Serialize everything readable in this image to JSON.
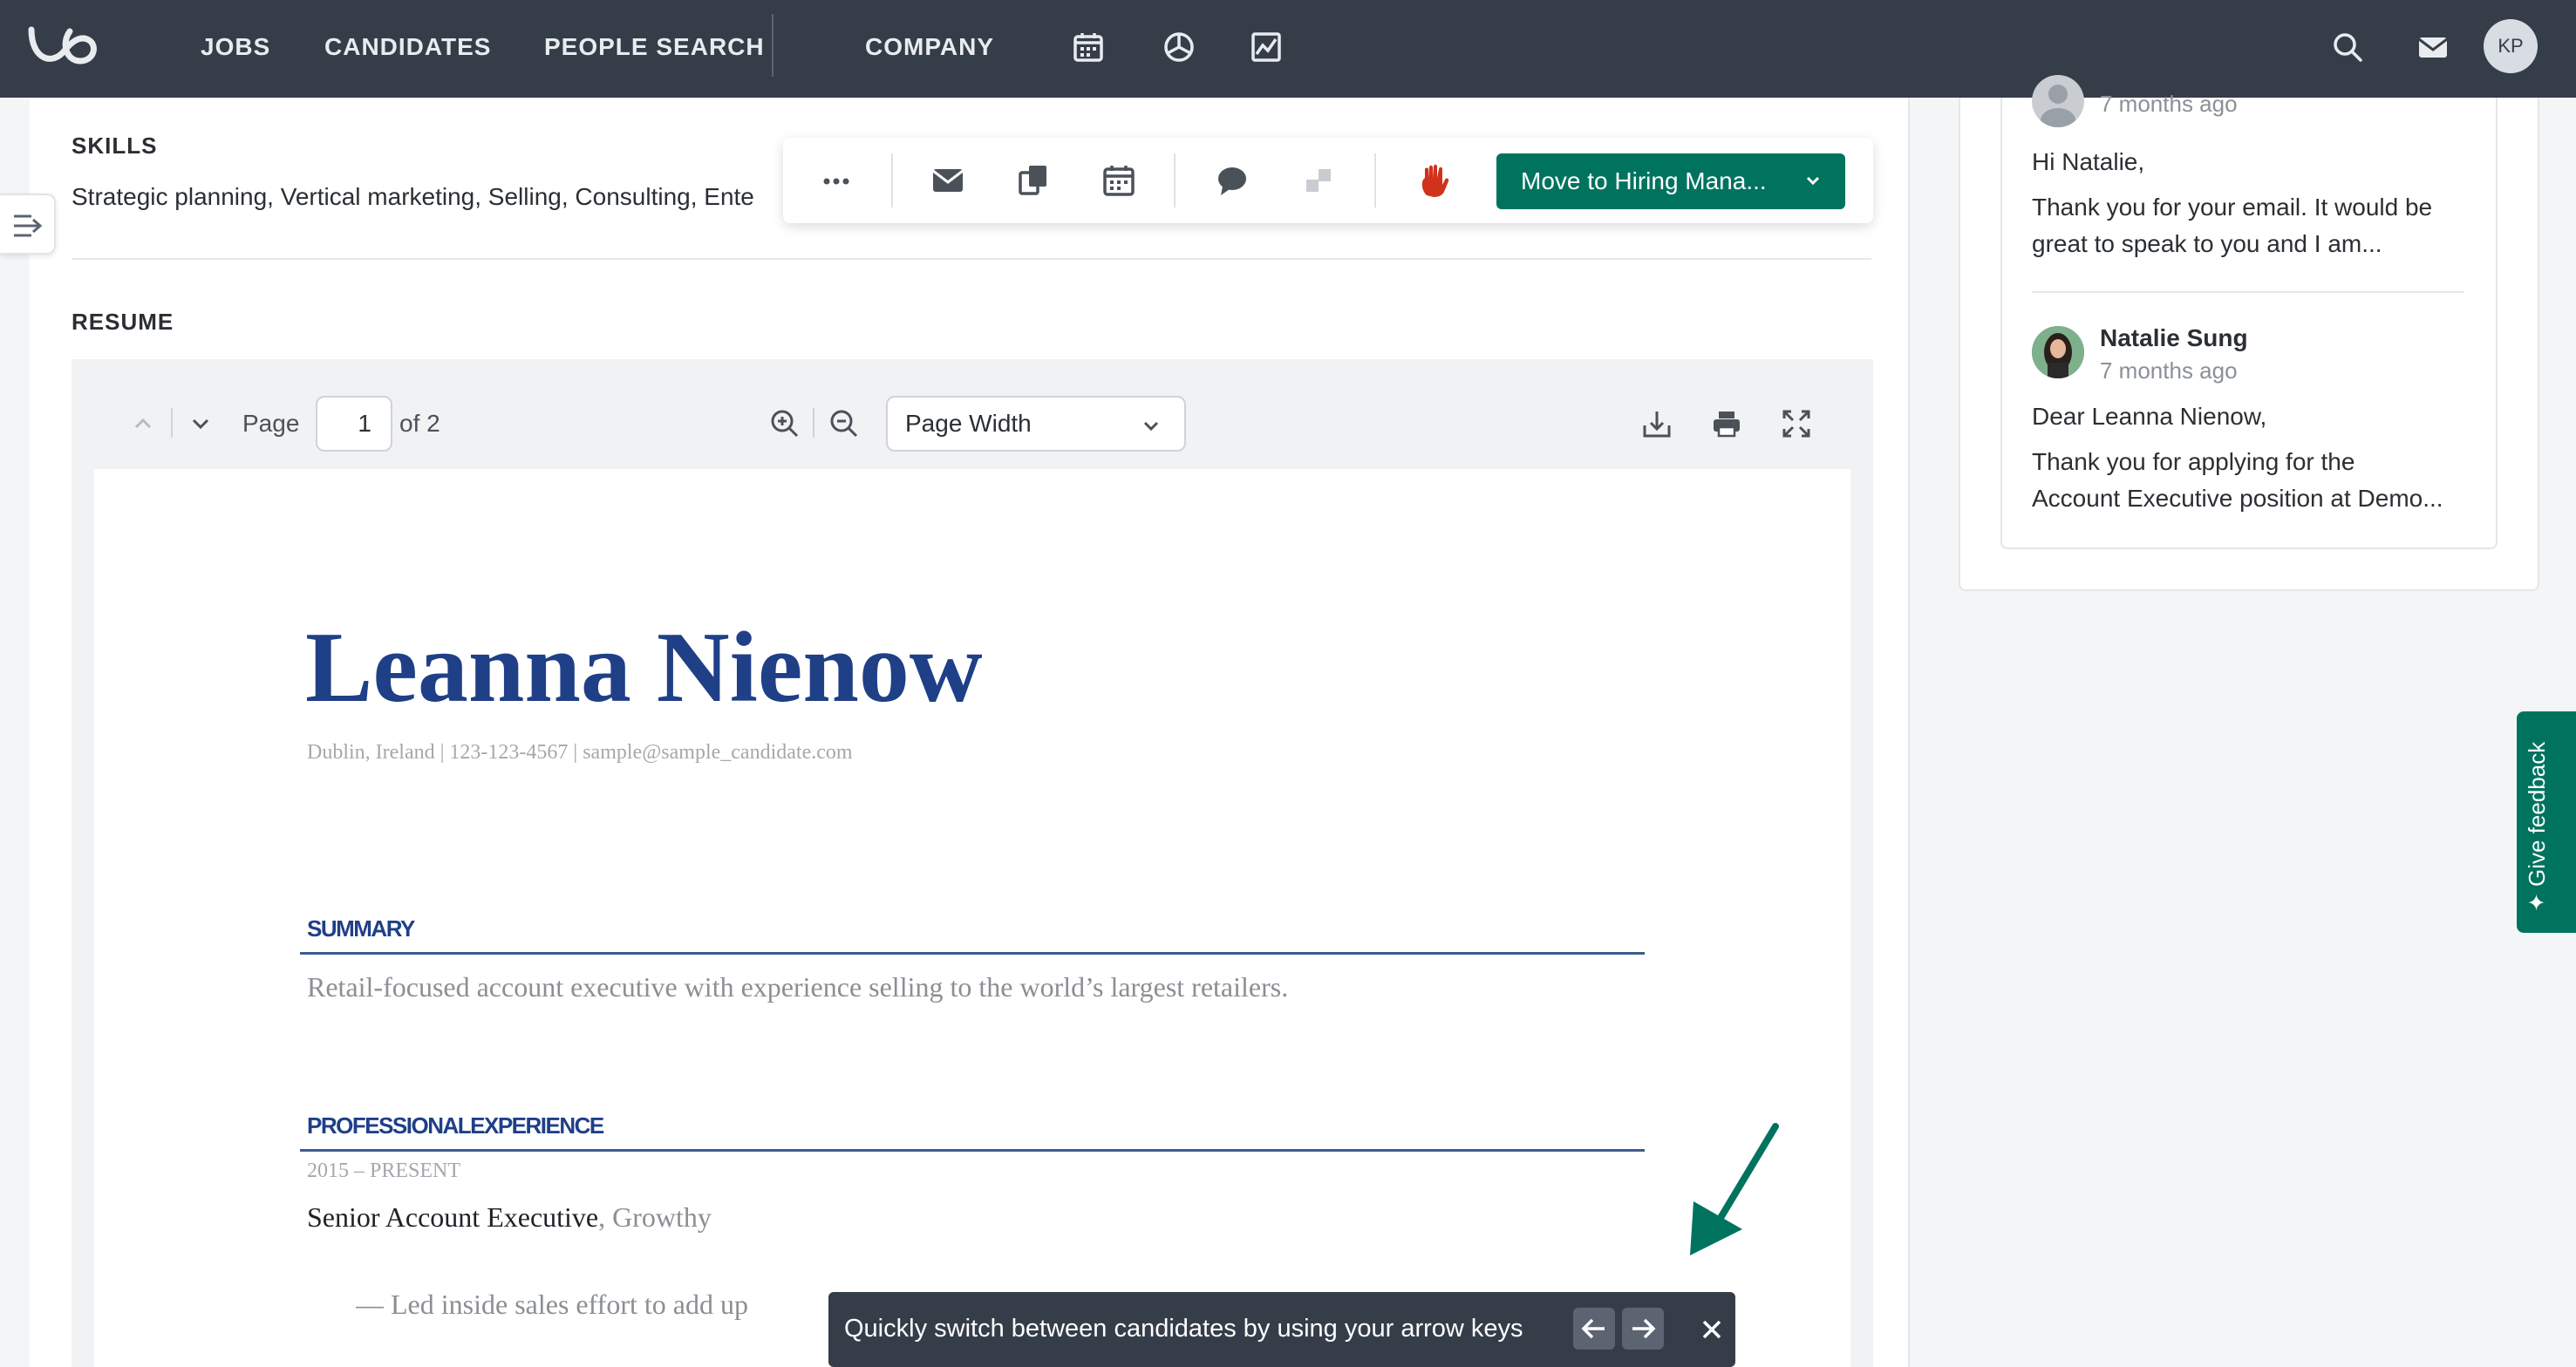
{
  "nav": {
    "items": [
      "JOBS",
      "CANDIDATES",
      "PEOPLE SEARCH",
      "COMPANY"
    ],
    "avatar_initials": "KP",
    "icons": [
      "calendar-icon",
      "pie-chart-icon",
      "analytics-icon",
      "search-icon",
      "mail-icon"
    ]
  },
  "skills": {
    "label": "SKILLS",
    "text": "Strategic planning, Vertical marketing, Selling, Consulting, Ente"
  },
  "action_bar": {
    "move_button_label": "Move to Hiring Mana...",
    "icons": [
      "more-icon",
      "email-icon",
      "share-icon",
      "calendar-icon",
      "comment-icon",
      "move-icon",
      "disqualify-hand-icon",
      "chevron-down-icon"
    ]
  },
  "resume": {
    "label": "RESUME",
    "toolbar": {
      "page_label": "Page",
      "page_value": "1",
      "page_total": "of 2",
      "zoom_value": "Page Width"
    },
    "document": {
      "name": "Leanna Nienow",
      "contact": "Dublin, Ireland | 123-123-4567 | sample@sample_candidate.com",
      "summary_heading": "SUMMARY",
      "summary_text": "Retail-focused  account executive with experience  selling to the world’s  largest retailers.",
      "experience_heading": "PROFESSIONALEXPERIENCE",
      "experience_dates": "2015 – PRESENT",
      "job_title": "Senior Account Executive",
      "job_company": ", Growthy",
      "bullet": "—   Led  inside sales  effort to add  up"
    }
  },
  "messages": {
    "first_time": "7 months ago",
    "first_greeting": "Hi Natalie,",
    "first_line1": "Thank you for your email. It would be",
    "first_line2": "great to speak to you and I am...",
    "second_author": "Natalie Sung",
    "second_time": "7 months ago",
    "second_greeting": "Dear Leanna Nienow,",
    "second_line1": "Thank you for applying for the",
    "second_line2": "Account Executive position at Demo..."
  },
  "feedback": {
    "label": "✦ Give feedback"
  },
  "toast": {
    "text": "Quickly switch between candidates by using your arrow keys"
  },
  "colors": {
    "topbar": "#353d49",
    "brand_green": "#00735f",
    "resume_blue": "#1f3f87",
    "hand_red": "#d0321c"
  }
}
